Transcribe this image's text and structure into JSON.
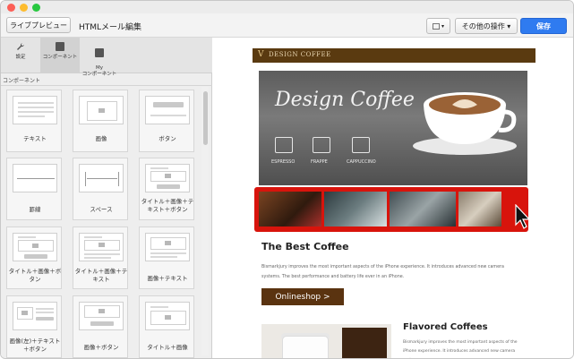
{
  "toolbar": {
    "live_preview": "ライブプレビュー",
    "editor_title": "HTMLメール編集",
    "other_actions": "その他の操作 ▾",
    "save": "保存",
    "square_dropdown_caret": "▾"
  },
  "sidebar": {
    "tabs": [
      {
        "label": "設定",
        "icon": "wrench-icon"
      },
      {
        "label": "コンポーネント",
        "icon": "folder-icon"
      },
      {
        "label": "My\nコンポーネント",
        "icon": "folder-user-icon"
      }
    ],
    "section_title": "コンポーネント",
    "components": [
      {
        "label": "テキスト"
      },
      {
        "label": "画像"
      },
      {
        "label": "ボタン"
      },
      {
        "label": "罫線"
      },
      {
        "label": "スペース"
      },
      {
        "label": "タイトル＋画像＋テキスト＋ボタン"
      },
      {
        "label": "タイトル＋画像＋ボタン"
      },
      {
        "label": "タイトル＋画像＋テキスト"
      },
      {
        "label": "画像＋テキスト"
      },
      {
        "label": "画像(左)＋テキスト＋ボタン"
      },
      {
        "label": "画像＋ボタン"
      },
      {
        "label": "タイトル＋画像"
      }
    ],
    "button_placeholder_text": "Button"
  },
  "preview": {
    "header_logo": "V",
    "header_brand": "DESIGN COFFEE",
    "hero_title": "Design Coffee",
    "hero_icons": [
      "ESPRESSO",
      "FRAPPE",
      "CAPPUCCINO"
    ],
    "section_title": "The Best Coffee",
    "section_body": "Bismarkjury improves the most important aspects of the iPhone experience. It introduces advanced new camera systems. The best performance and battery life ever in an iPhone.",
    "shop_button": "Onlineshop >",
    "product_title": "Flavored Coffees",
    "product_body": "Bismarkjury improves the most important aspects of the iPhone experience. It introduces advanced new camera systems."
  }
}
